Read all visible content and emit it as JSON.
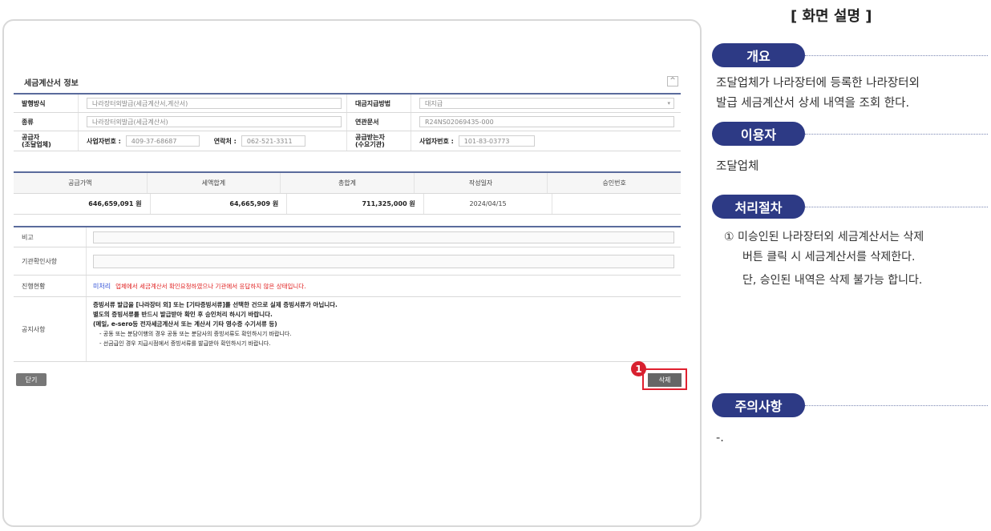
{
  "screen": {
    "panel_title": "세금계산서 정보",
    "collapse_symbol": "^",
    "info": {
      "issue_method_label": "발행방식",
      "issue_method_value": "나라장터외발급(세금계산서,계산서)",
      "payment_method_label": "대금지급방법",
      "payment_method_value": "대지급",
      "type_label": "종류",
      "type_value": "나라장터외발급(세금계산서)",
      "related_doc_label": "연관문서",
      "related_doc_value": "R24NS02069435-000",
      "supplier_label": "공급자",
      "supplier_label_sub": "(조달업체)",
      "supplier_bizno_label": "사업자번호 :",
      "supplier_bizno_value": "409-37-68687",
      "contact_label": "연락처 :",
      "contact_value": "062-521-3311",
      "receiver_label": "공급받는자",
      "receiver_label_sub": "(수요기관)",
      "receiver_bizno_label": "사업자번호 :",
      "receiver_bizno_value": "101-83-03773"
    },
    "summary": {
      "headers": [
        "공급가액",
        "세액합계",
        "총합계",
        "작성일자",
        "승인번호"
      ],
      "values": [
        "646,659,091 원",
        "64,665,909 원",
        "711,325,000 원",
        "2024/04/15",
        ""
      ]
    },
    "remarks": {
      "note_label": "비고",
      "agency_check_label": "기관확인사항",
      "status_label": "진행현황",
      "status_value": "미처리",
      "status_message": "업체에서 세금계산서 확인요청하였으나 기관에서 응답하지 않은 상태입니다.",
      "notice_label": "공지사항",
      "notice_lines": [
        "증빙서류 발급을 [나라장터 외] 또는 [기타증빙서류]를 선택한 건으로 실제 증빙서류가 아닙니다.",
        "별도의 증빙서류를 반드시 발급받아 확인 후 승인처리 하시기 바랍니다.",
        "(메일, e-sero등 전자세금계산서 또는 계산서 기타 영수증 수기서류 등)"
      ],
      "notice_sublines": [
        "- 공동 또는 분담이행의 경우 공동 또는 분담사의 증빙서류도 확인하시기 바랍니다.",
        "- 선금급인 경우 지급시점에서 증빙서류를 발급받아 확인하시기 바랍니다."
      ]
    },
    "close_button": "닫기",
    "delete_button": "삭제",
    "step_badge": "1"
  },
  "description": {
    "title": "[ 화면 설명 ]",
    "overview_title": "개요",
    "overview_lines": [
      "조달업체가 나라장터에 등록한 나라장터외",
      "발급 세금계산서 상세 내역을 조회 한다."
    ],
    "user_title": "이용자",
    "user_text": "조달업체",
    "procedure_title": "처리절차",
    "procedure_lines": [
      "① 미승인된 나라장터외 세금계산서는 삭제",
      "버튼 클릭 시 세금계산서를 삭제한다.",
      "단, 승인된 내역은 삭제 불가능 합니다."
    ],
    "caution_title": "주의사항",
    "caution_text": "-."
  },
  "colors": {
    "accent_navy": "#2d3a85",
    "highlight_red": "#e0202f",
    "table_border": "#5a6b9c"
  }
}
